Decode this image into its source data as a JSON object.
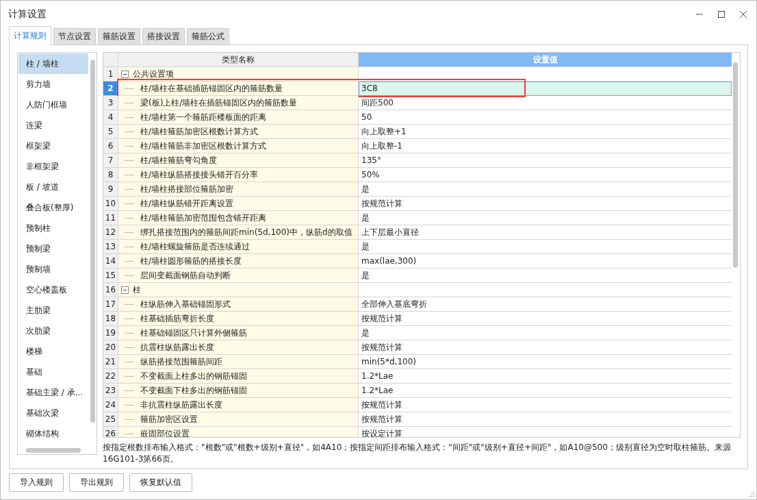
{
  "window": {
    "title": "计算设置"
  },
  "tabs": [
    {
      "label": "计算规则",
      "selected": true
    },
    {
      "label": "节点设置",
      "selected": false
    },
    {
      "label": "箍筋设置",
      "selected": false
    },
    {
      "label": "搭接设置",
      "selected": false
    },
    {
      "label": "箍筋公式",
      "selected": false
    }
  ],
  "sidebar": {
    "items": [
      {
        "label": "柱 / 墙柱",
        "selected": true
      },
      {
        "label": "剪力墙",
        "selected": false
      },
      {
        "label": "人防门框墙",
        "selected": false
      },
      {
        "label": "连梁",
        "selected": false
      },
      {
        "label": "框架梁",
        "selected": false
      },
      {
        "label": "非框架梁",
        "selected": false
      },
      {
        "label": "板 / 坡道",
        "selected": false
      },
      {
        "label": "叠合板(整厚)",
        "selected": false
      },
      {
        "label": "预制柱",
        "selected": false
      },
      {
        "label": "预制梁",
        "selected": false
      },
      {
        "label": "预制墙",
        "selected": false
      },
      {
        "label": "空心楼盖板",
        "selected": false
      },
      {
        "label": "主肋梁",
        "selected": false
      },
      {
        "label": "次肋梁",
        "selected": false
      },
      {
        "label": "楼梯",
        "selected": false
      },
      {
        "label": "基础",
        "selected": false
      },
      {
        "label": "基础主梁 / 承...",
        "selected": false
      },
      {
        "label": "基础次梁",
        "selected": false
      },
      {
        "label": "砌体结构",
        "selected": false
      }
    ]
  },
  "table": {
    "columns": [
      "类型名称",
      "设置值"
    ],
    "groups": [
      {
        "number": "1",
        "name": "公共设置项",
        "expanded": true,
        "children": [
          {
            "number": "2",
            "name": "柱/墙柱在基础插筋锚固区内的箍筋数量",
            "value": "3C8",
            "selected": true,
            "annotated": true
          },
          {
            "number": "3",
            "name": "梁(板)上柱/墙柱在插筋锚固区内的箍筋数量",
            "value": "间距500",
            "selected": false,
            "annotated": false
          },
          {
            "number": "4",
            "name": "柱/墙柱第一个箍筋距楼板面的距离",
            "value": "50",
            "selected": false,
            "annotated": false
          },
          {
            "number": "5",
            "name": "柱/墙柱箍筋加密区根数计算方式",
            "value": "向上取整+1",
            "selected": false,
            "annotated": false
          },
          {
            "number": "6",
            "name": "柱/墙柱箍筋非加密区根数计算方式",
            "value": "向上取整-1",
            "selected": false,
            "annotated": false
          },
          {
            "number": "7",
            "name": "柱/墙柱箍筋弯勾角度",
            "value": "135°",
            "selected": false,
            "annotated": false
          },
          {
            "number": "8",
            "name": "柱/墙柱纵筋搭接接头错开百分率",
            "value": "50%",
            "selected": false,
            "annotated": false
          },
          {
            "number": "9",
            "name": "柱/墙柱搭接部位箍筋加密",
            "value": "是",
            "selected": false,
            "annotated": false
          },
          {
            "number": "10",
            "name": "柱/墙柱纵筋错开距离设置",
            "value": "按规范计算",
            "selected": false,
            "annotated": false
          },
          {
            "number": "11",
            "name": "柱/墙柱箍筋加密范围包含错开距离",
            "value": "是",
            "selected": false,
            "annotated": false
          },
          {
            "number": "12",
            "name": "绑扎搭接范围内的箍筋间距min(5d,100)中，纵筋d的取值",
            "value": "上下层最小直径",
            "selected": false,
            "annotated": false
          },
          {
            "number": "13",
            "name": "柱/墙柱螺旋箍筋是否连续通过",
            "value": "是",
            "selected": false,
            "annotated": false
          },
          {
            "number": "14",
            "name": "柱/墙柱圆形箍筋的搭接长度",
            "value": "max(lae,300)",
            "selected": false,
            "annotated": false
          },
          {
            "number": "15",
            "name": "层间变截面钢筋自动判断",
            "value": "是",
            "selected": false,
            "annotated": false
          }
        ]
      },
      {
        "number": "16",
        "name": "柱",
        "expanded": true,
        "children": [
          {
            "number": "17",
            "name": "柱纵筋伸入基础锚固形式",
            "value": "全部伸入基底弯折",
            "selected": false,
            "annotated": false
          },
          {
            "number": "18",
            "name": "柱基础插筋弯折长度",
            "value": "按规范计算",
            "selected": false,
            "annotated": false
          },
          {
            "number": "19",
            "name": "柱基础锚固区只计算外侧箍筋",
            "value": "是",
            "selected": false,
            "annotated": false
          },
          {
            "number": "20",
            "name": "抗震柱纵筋露出长度",
            "value": "按规范计算",
            "selected": false,
            "annotated": false
          },
          {
            "number": "21",
            "name": "纵筋搭接范围箍筋间距",
            "value": "min(5*d,100)",
            "selected": false,
            "annotated": false
          },
          {
            "number": "22",
            "name": "不变截面上柱多出的钢筋锚固",
            "value": "1.2*Lae",
            "selected": false,
            "annotated": false
          },
          {
            "number": "23",
            "name": "不变截面下柱多出的钢筋锚固",
            "value": "1.2*Lae",
            "selected": false,
            "annotated": false
          },
          {
            "number": "24",
            "name": "非抗震柱纵筋露出长度",
            "value": "按规范计算",
            "selected": false,
            "annotated": false
          },
          {
            "number": "25",
            "name": "箍筋加密区设置",
            "value": "按规范计算",
            "selected": false,
            "annotated": false
          },
          {
            "number": "26",
            "name": "嵌固部位设置",
            "value": "按设定计算",
            "selected": false,
            "annotated": false
          }
        ]
      }
    ]
  },
  "hint": "按指定根数排布输入格式：\"根数\"或\"根数+级别+直径\"，如4A10；按指定间距排布输入格式：\"间距\"或\"级别+直径+间距\"，如A10@500；级别直径为空时取柱箍筋。来源16G101-3第66页。",
  "buttons": [
    "导入规则",
    "导出规则",
    "恢复默认值"
  ]
}
